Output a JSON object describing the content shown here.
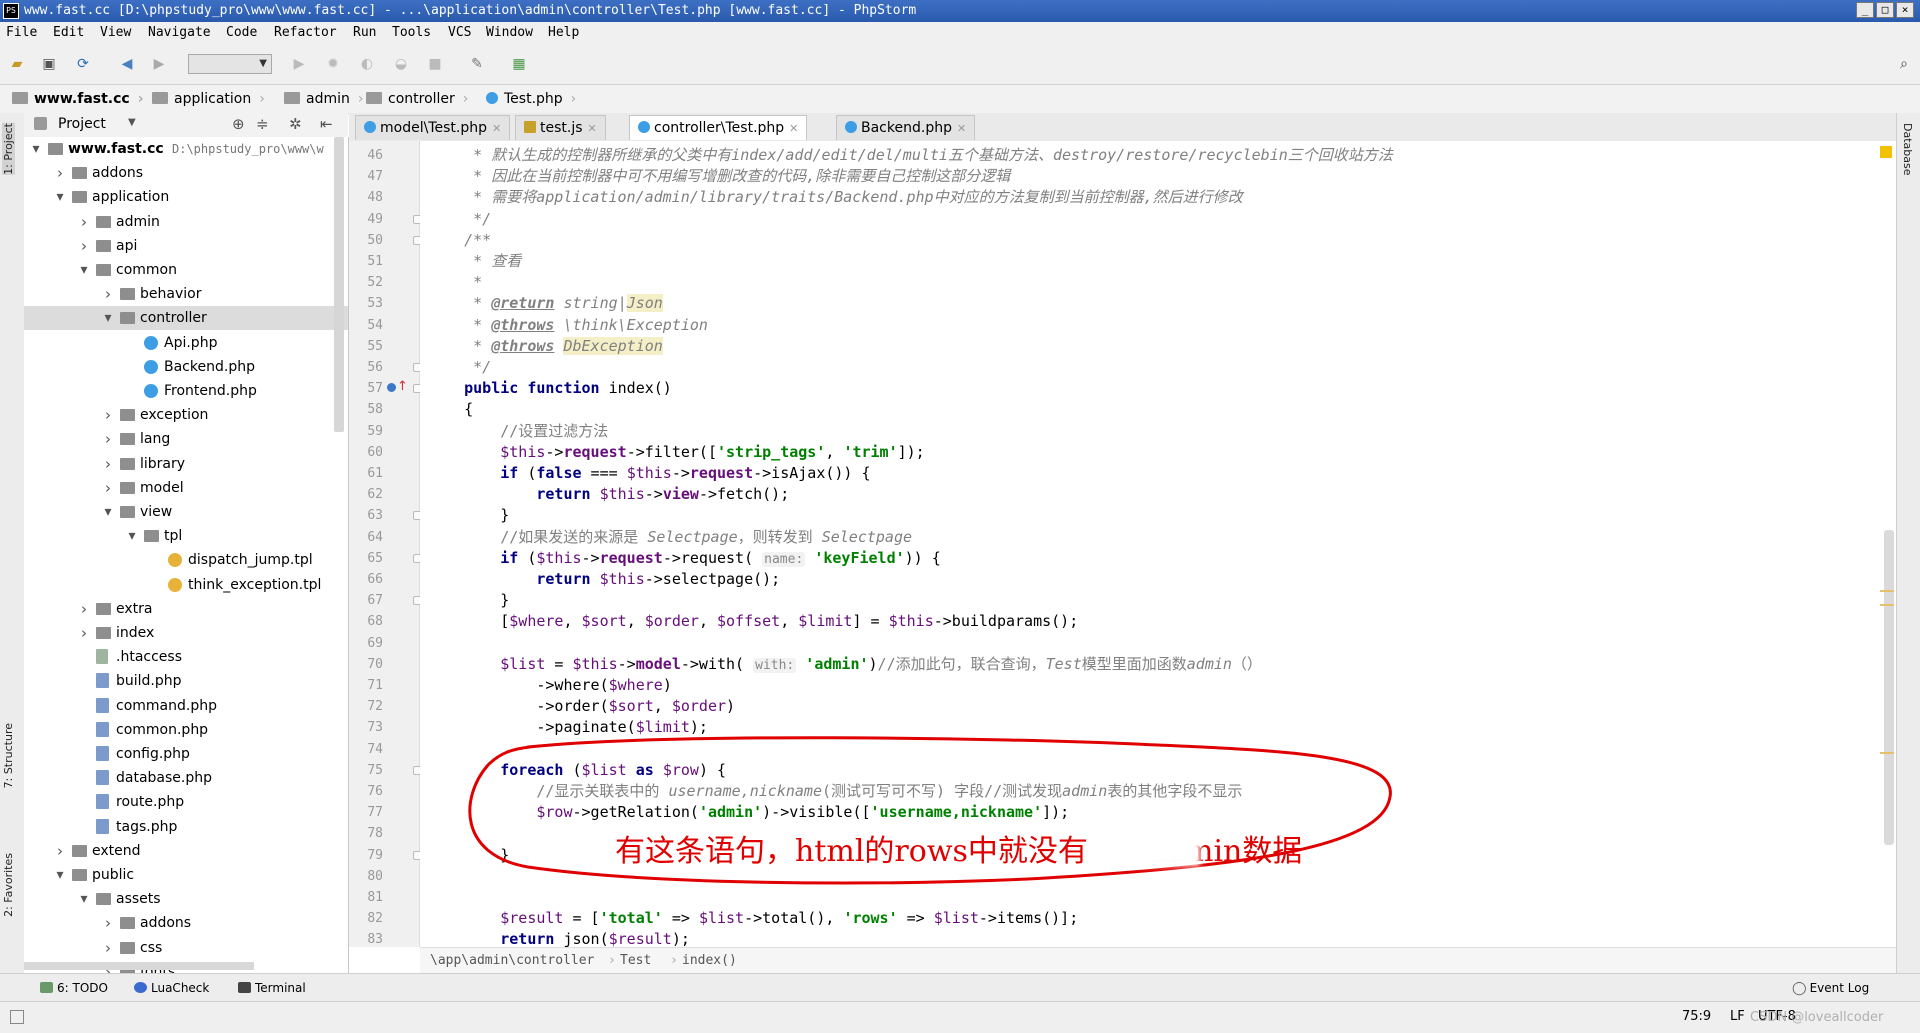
{
  "window": {
    "title": "www.fast.cc [D:\\phpstudy_pro\\www\\www.fast.cc] - ...\\application\\admin\\controller\\Test.php [www.fast.cc] - PhpStorm",
    "min": "_",
    "max": "□",
    "close": "×"
  },
  "menu": [
    "File",
    "Edit",
    "View",
    "Navigate",
    "Code",
    "Refactor",
    "Run",
    "Tools",
    "VCS",
    "Window",
    "Help"
  ],
  "breadcrumb": [
    "www.fast.cc",
    "application",
    "admin",
    "controller",
    "Test.php"
  ],
  "left_tabs": {
    "project": "1: Project",
    "structure": "7: Structure",
    "favorites": "2: Favorites"
  },
  "right_tabs": {
    "database": "Database"
  },
  "project": {
    "label": "Project"
  },
  "tree": [
    {
      "d": 0,
      "t": "open",
      "i": "folder",
      "label": "www.fast.cc",
      "path": "D:\\phpstudy_pro\\www\\w"
    },
    {
      "d": 1,
      "t": "closed",
      "i": "folder",
      "label": "addons"
    },
    {
      "d": 1,
      "t": "open",
      "i": "folder",
      "label": "application"
    },
    {
      "d": 2,
      "t": "closed",
      "i": "folder",
      "label": "admin"
    },
    {
      "d": 2,
      "t": "closed",
      "i": "folder",
      "label": "api"
    },
    {
      "d": 2,
      "t": "open",
      "i": "folder",
      "label": "common"
    },
    {
      "d": 3,
      "t": "closed",
      "i": "folder",
      "label": "behavior"
    },
    {
      "d": 3,
      "t": "open",
      "i": "folder",
      "label": "controller",
      "sel": true
    },
    {
      "d": 4,
      "t": "",
      "i": "cls",
      "label": "Api.php"
    },
    {
      "d": 4,
      "t": "",
      "i": "cls",
      "label": "Backend.php"
    },
    {
      "d": 4,
      "t": "",
      "i": "cls",
      "label": "Frontend.php"
    },
    {
      "d": 3,
      "t": "closed",
      "i": "folder",
      "label": "exception"
    },
    {
      "d": 3,
      "t": "closed",
      "i": "folder",
      "label": "lang"
    },
    {
      "d": 3,
      "t": "closed",
      "i": "folder",
      "label": "library"
    },
    {
      "d": 3,
      "t": "closed",
      "i": "folder",
      "label": "model"
    },
    {
      "d": 3,
      "t": "open",
      "i": "folder",
      "label": "view"
    },
    {
      "d": 4,
      "t": "open",
      "i": "folder",
      "label": "tpl"
    },
    {
      "d": 5,
      "t": "",
      "i": "tpl",
      "label": "dispatch_jump.tpl"
    },
    {
      "d": 5,
      "t": "",
      "i": "tpl",
      "label": "think_exception.tpl"
    },
    {
      "d": 2,
      "t": "closed",
      "i": "folder",
      "label": "extra"
    },
    {
      "d": 2,
      "t": "closed",
      "i": "folder",
      "label": "index"
    },
    {
      "d": 2,
      "t": "",
      "i": "ht",
      "label": ".htaccess"
    },
    {
      "d": 2,
      "t": "",
      "i": "php",
      "label": "build.php"
    },
    {
      "d": 2,
      "t": "",
      "i": "php",
      "label": "command.php"
    },
    {
      "d": 2,
      "t": "",
      "i": "php",
      "label": "common.php"
    },
    {
      "d": 2,
      "t": "",
      "i": "php",
      "label": "config.php"
    },
    {
      "d": 2,
      "t": "",
      "i": "php",
      "label": "database.php"
    },
    {
      "d": 2,
      "t": "",
      "i": "php",
      "label": "route.php"
    },
    {
      "d": 2,
      "t": "",
      "i": "php",
      "label": "tags.php"
    },
    {
      "d": 1,
      "t": "closed",
      "i": "folder",
      "label": "extend"
    },
    {
      "d": 1,
      "t": "open",
      "i": "folder",
      "label": "public"
    },
    {
      "d": 2,
      "t": "open",
      "i": "folder",
      "label": "assets"
    },
    {
      "d": 3,
      "t": "closed",
      "i": "folder",
      "label": "addons"
    },
    {
      "d": 3,
      "t": "closed",
      "i": "folder",
      "label": "css"
    },
    {
      "d": 3,
      "t": "closed",
      "i": "folder",
      "label": "fonts"
    }
  ],
  "tabs": [
    {
      "label": "model\\Test.php",
      "icon": "cls",
      "active": false
    },
    {
      "label": "test.js",
      "icon": "js",
      "active": false
    },
    {
      "label": "controller\\Test.php",
      "icon": "cls",
      "active": true
    },
    {
      "label": "Backend.php",
      "icon": "cls",
      "active": false
    }
  ],
  "code": [
    [
      46,
      [
        [
          "c-doc",
          "     * 默认生成的控制器所继承的父类中有index/add/edit/del/multi五个基础方法、destroy/restore/recyclebin三个回收站方法"
        ]
      ]
    ],
    [
      47,
      [
        [
          "c-doc",
          "     * 因此在当前控制器中可不用编写增删改查的代码,除非需要自己控制这部分逻辑"
        ]
      ]
    ],
    [
      48,
      [
        [
          "c-doc",
          "     * 需要将application/admin/library/traits/Backend.php中对应的方法复制到当前控制器,然后进行修改"
        ]
      ]
    ],
    [
      49,
      [
        [
          "c-doc",
          "     */"
        ]
      ]
    ],
    [
      50,
      [
        [
          "c-doc",
          "    /**"
        ]
      ]
    ],
    [
      51,
      [
        [
          "c-doc",
          "     * 查看"
        ]
      ]
    ],
    [
      52,
      [
        [
          "c-doc",
          "     *"
        ]
      ]
    ],
    [
      53,
      [
        [
          "c-doc",
          "     * "
        ],
        [
          "c-tag",
          "@return"
        ],
        [
          "c-doc",
          " string|"
        ],
        [
          "c-doc c-hl",
          "Json"
        ]
      ]
    ],
    [
      54,
      [
        [
          "c-doc",
          "     * "
        ],
        [
          "c-tag",
          "@throws"
        ],
        [
          "c-doc",
          " \\think\\Exception"
        ]
      ]
    ],
    [
      55,
      [
        [
          "c-doc",
          "     * "
        ],
        [
          "c-tag",
          "@throws"
        ],
        [
          "c-doc",
          " "
        ],
        [
          "c-doc c-hl",
          "DbException"
        ]
      ]
    ],
    [
      56,
      [
        [
          "c-doc",
          "     */"
        ]
      ]
    ],
    [
      57,
      [
        [
          "",
          "    "
        ],
        [
          "c-kw",
          "public function"
        ],
        [
          "",
          " index()"
        ]
      ]
    ],
    [
      58,
      [
        [
          "",
          "    {"
        ]
      ]
    ],
    [
      59,
      [
        [
          "c-com",
          "        //设置过滤方法"
        ]
      ]
    ],
    [
      60,
      [
        [
          "",
          "        "
        ],
        [
          "c-var",
          "$this"
        ],
        [
          "",
          "->"
        ],
        [
          "c-prop",
          "request"
        ],
        [
          "",
          "->filter(["
        ],
        [
          "c-str",
          "'strip_tags'"
        ],
        [
          ", "
        ],
        [
          "c-str",
          "'trim'"
        ],
        [
          "",
          "]);"
        ]
      ]
    ],
    [
      61,
      [
        [
          "",
          "        "
        ],
        [
          "c-kw",
          "if"
        ],
        [
          "",
          " ("
        ],
        [
          "c-kw",
          "false"
        ],
        [
          "",
          " === "
        ],
        [
          "c-var",
          "$this"
        ],
        [
          "",
          "->"
        ],
        [
          "c-prop",
          "request"
        ],
        [
          "",
          "->isAjax()) {"
        ]
      ]
    ],
    [
      62,
      [
        [
          "",
          "            "
        ],
        [
          "c-kw",
          "return"
        ],
        [
          "",
          " "
        ],
        [
          "c-var",
          "$this"
        ],
        [
          "",
          "->"
        ],
        [
          "c-prop",
          "view"
        ],
        [
          "",
          "->fetch();"
        ]
      ]
    ],
    [
      63,
      [
        [
          "",
          "        }"
        ]
      ]
    ],
    [
      64,
      [
        [
          "c-com",
          "        //如果发送的来源是 "
        ],
        [
          "c-doc",
          "Selectpage"
        ],
        [
          "c-com",
          "，则转发到 "
        ],
        [
          "c-doc",
          "Selectpage"
        ]
      ]
    ],
    [
      65,
      [
        [
          "",
          "        "
        ],
        [
          "c-kw",
          "if"
        ],
        [
          "",
          " ("
        ],
        [
          "c-var",
          "$this"
        ],
        [
          "",
          "->"
        ],
        [
          "c-prop",
          "request"
        ],
        [
          "",
          "->request( "
        ],
        [
          "c-hint",
          "name:"
        ],
        [
          " "
        ],
        [
          "c-str",
          "'keyField'"
        ],
        [
          "",
          ")) {"
        ]
      ]
    ],
    [
      66,
      [
        [
          "",
          "            "
        ],
        [
          "c-kw",
          "return"
        ],
        [
          "",
          " "
        ],
        [
          "c-var",
          "$this"
        ],
        [
          "",
          "->selectpage();"
        ]
      ]
    ],
    [
      67,
      [
        [
          "",
          "        }"
        ]
      ]
    ],
    [
      68,
      [
        [
          "",
          "        ["
        ],
        [
          "c-var",
          "$where"
        ],
        [
          ", "
        ],
        [
          "c-var",
          "$sort"
        ],
        [
          ", "
        ],
        [
          "c-var",
          "$order"
        ],
        [
          ", "
        ],
        [
          "c-var",
          "$offset"
        ],
        [
          ", "
        ],
        [
          "c-var",
          "$limit"
        ],
        [
          "",
          "] = "
        ],
        [
          "c-var",
          "$this"
        ],
        [
          "",
          "->buildparams();"
        ]
      ]
    ],
    [
      69,
      [
        [
          "",
          ""
        ]
      ]
    ],
    [
      70,
      [
        [
          "",
          "        "
        ],
        [
          "c-var",
          "$list"
        ],
        [
          "",
          " = "
        ],
        [
          "c-var",
          "$this"
        ],
        [
          "",
          "->"
        ],
        [
          "c-prop",
          "model"
        ],
        [
          "",
          "->with( "
        ],
        [
          "c-hint",
          "with:"
        ],
        [
          " "
        ],
        [
          "c-str",
          "'admin'"
        ],
        [
          "",
          ")"
        ],
        [
          "c-com",
          "//添加此句，联合查询，"
        ],
        [
          "c-doc",
          "Test"
        ],
        [
          "c-com",
          "模型里面加函数"
        ],
        [
          "c-doc",
          "admin"
        ],
        [
          "c-com",
          "（）"
        ]
      ]
    ],
    [
      71,
      [
        [
          "",
          "            ->where("
        ],
        [
          "c-var",
          "$where"
        ],
        [
          "",
          ")"
        ]
      ]
    ],
    [
      72,
      [
        [
          "",
          "            ->order("
        ],
        [
          "c-var",
          "$sort"
        ],
        [
          ", "
        ],
        [
          "c-var",
          "$order"
        ],
        [
          "",
          ")"
        ]
      ]
    ],
    [
      73,
      [
        [
          "",
          "            ->paginate("
        ],
        [
          "c-var",
          "$limit"
        ],
        [
          "",
          ");"
        ]
      ]
    ],
    [
      74,
      [
        [
          "",
          ""
        ]
      ]
    ],
    [
      75,
      [
        [
          "",
          "        "
        ],
        [
          "c-kw",
          "foreach"
        ],
        [
          "",
          " ("
        ],
        [
          "c-var",
          "$list"
        ],
        [
          "",
          " "
        ],
        [
          "c-kw",
          "as"
        ],
        [
          "",
          " "
        ],
        [
          "c-var",
          "$row"
        ],
        [
          "",
          ") {"
        ]
      ]
    ],
    [
      76,
      [
        [
          "c-com",
          "            //显示关联表中的 "
        ],
        [
          "c-doc",
          "username,nickname"
        ],
        [
          "c-com",
          "(测试可写可不写) 字段//测试发现"
        ],
        [
          "c-doc",
          "admin"
        ],
        [
          "c-com",
          "表的其他字段不显示"
        ]
      ]
    ],
    [
      77,
      [
        [
          "",
          "            "
        ],
        [
          "c-var",
          "$row"
        ],
        [
          "",
          "->getRelation("
        ],
        [
          "c-str",
          "'admin'"
        ],
        [
          "",
          ")->visible(["
        ],
        [
          "c-str",
          "'username,nickname'"
        ],
        [
          "",
          "]);"
        ]
      ]
    ],
    [
      78,
      [
        [
          "",
          ""
        ]
      ]
    ],
    [
      79,
      [
        [
          "",
          "        }"
        ]
      ]
    ],
    [
      80,
      [
        [
          "",
          ""
        ]
      ]
    ],
    [
      81,
      [
        [
          "",
          ""
        ]
      ]
    ],
    [
      82,
      [
        [
          "",
          "        "
        ],
        [
          "c-var",
          "$result"
        ],
        [
          "",
          " = ["
        ],
        [
          "c-str",
          "'total'"
        ],
        [
          "",
          " => "
        ],
        [
          "c-var",
          "$list"
        ],
        [
          "",
          "->total(), "
        ],
        [
          "c-str",
          "'rows'"
        ],
        [
          "",
          " => "
        ],
        [
          "c-var",
          "$list"
        ],
        [
          "",
          "->items()];"
        ]
      ]
    ],
    [
      83,
      [
        [
          "",
          "        "
        ],
        [
          "c-kw",
          "return"
        ],
        [
          "",
          " json("
        ],
        [
          "c-var",
          "$result"
        ],
        [
          "",
          ");"
        ]
      ]
    ]
  ],
  "editor_breadcrumb": [
    "\\app\\admin\\controller",
    "Test",
    "index()"
  ],
  "annotation": {
    "text": "有这条语句，html的rows中就没有",
    "text_end": "admin数据"
  },
  "tool_windows": {
    "todo": "6: TODO",
    "luacheck": "LuaCheck",
    "terminal": "Terminal",
    "event_log": "Event Log"
  },
  "status": {
    "position": "75:9",
    "line_sep": "LF",
    "encoding": "UTF-8"
  },
  "watermark": "CSDN @loveallcoder"
}
